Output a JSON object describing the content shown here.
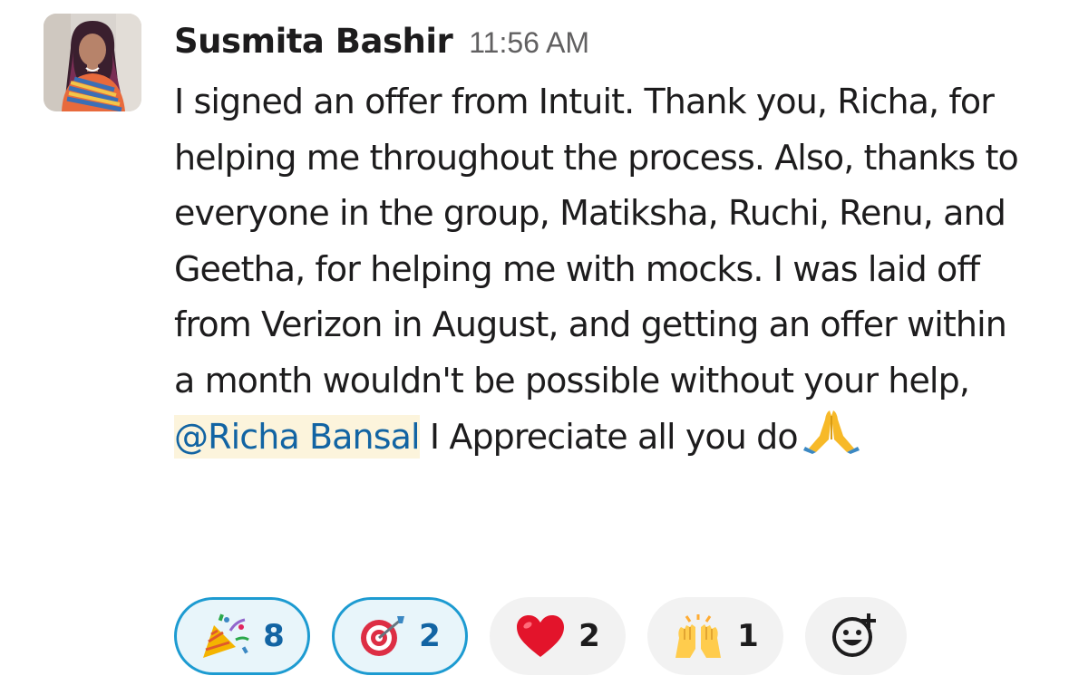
{
  "message": {
    "author": "Susmita Bashir",
    "timestamp": "11:56 AM",
    "text_before_mention": "I signed an offer from Intuit. Thank you, Richa, for helping me throughout the process. Also, thanks to everyone in the group, Matiksha, Ruchi, Renu, and Geetha, for helping me with mocks. I was laid off from Verizon in August, and getting an offer within a month wouldn't be possible without your help, ",
    "mention": "@Richa Bansal",
    "text_after_mention": " I Appreciate all you do",
    "trailing_emoji": "folded-hands-icon"
  },
  "reactions": [
    {
      "emoji": "party-popper-icon",
      "count": "8",
      "active": true
    },
    {
      "emoji": "direct-hit-icon",
      "count": "2",
      "active": true
    },
    {
      "emoji": "red-heart-icon",
      "count": "2",
      "active": false
    },
    {
      "emoji": "raising-hands-icon",
      "count": "1",
      "active": false
    }
  ],
  "add_reaction": {
    "icon": "add-reaction-icon"
  },
  "colors": {
    "mention_text": "#1264a3",
    "mention_background": "#fcf4dc",
    "active_reaction_border": "#1d9bd1",
    "active_reaction_background": "#e8f5fa",
    "inactive_reaction_background": "#f2f2f2",
    "timestamp": "#616061"
  }
}
